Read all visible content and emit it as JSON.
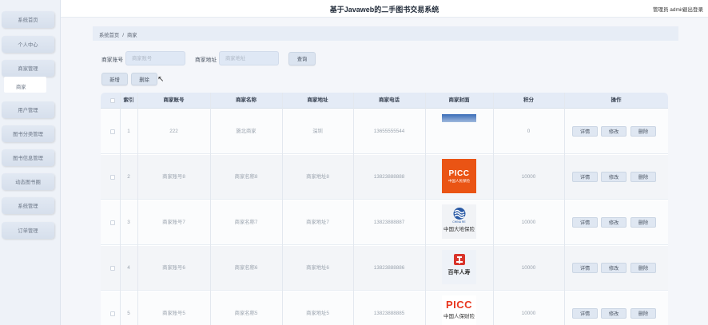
{
  "app": {
    "title": "基于Javaweb的二手图书交易系统",
    "user_label": "管理员 admin",
    "logout_label": "退出登录"
  },
  "sidebar": {
    "items": [
      {
        "label": "系统首页"
      },
      {
        "label": "个人中心"
      },
      {
        "label": "商家管理"
      },
      {
        "label": "用户管理"
      },
      {
        "label": "图书分类管理"
      },
      {
        "label": "图书信息管理"
      },
      {
        "label": "动态图书圈"
      },
      {
        "label": "系统管理"
      },
      {
        "label": "订单管理"
      }
    ],
    "sub_item": "商家"
  },
  "breadcrumb": {
    "home": "系统首页",
    "separator": "/",
    "current": "商家"
  },
  "search": {
    "account_label": "商家账号",
    "account_placeholder": "商家账号",
    "address_label": "商家地址",
    "address_placeholder": "商家地址",
    "query_button": "查询"
  },
  "toolbar": {
    "add_label": "新增",
    "delete_label": "删除"
  },
  "table": {
    "headers": {
      "index": "索引",
      "account": "商家账号",
      "name": "商家名称",
      "address": "商家地址",
      "phone": "商家电话",
      "cover": "商家封面",
      "points": "积分",
      "actions": "操作"
    },
    "rows": [
      {
        "index": "1",
        "account": "222",
        "name": "施北商家",
        "address": "深圳",
        "phone": "13655555544",
        "points": "0",
        "logo": "blue-image"
      },
      {
        "index": "2",
        "account": "商家账号8",
        "name": "商家名称8",
        "address": "商家地址8",
        "phone": "13823888888",
        "points": "10000",
        "logo": "picc-orange"
      },
      {
        "index": "3",
        "account": "商家账号7",
        "name": "商家名称7",
        "address": "商家地址7",
        "phone": "13823888887",
        "points": "10000",
        "logo": "china-re"
      },
      {
        "index": "4",
        "account": "商家账号6",
        "name": "商家名称6",
        "address": "商家地址6",
        "phone": "13823888886",
        "points": "10000",
        "logo": "bainian-renshou"
      },
      {
        "index": "5",
        "account": "商家账号5",
        "name": "商家名称5",
        "address": "商家地址5",
        "phone": "13823888885",
        "points": "10000",
        "logo": "picc-red"
      }
    ],
    "actions": {
      "detail": "详情",
      "edit": "修改",
      "delete": "删除"
    }
  },
  "logos": {
    "picc1_big": "PICC",
    "picc1_small": "中国人民保险",
    "china_en": "CHINA RE",
    "china_cn": "中国大地保险",
    "bainian_cn": "百年人寿",
    "picc2_big": "PICC",
    "picc2_small": "中国人保财险"
  },
  "colors": {
    "accent": "#e4ebf6",
    "picc_orange": "#ea5414",
    "picc_red": "#e8361e"
  }
}
